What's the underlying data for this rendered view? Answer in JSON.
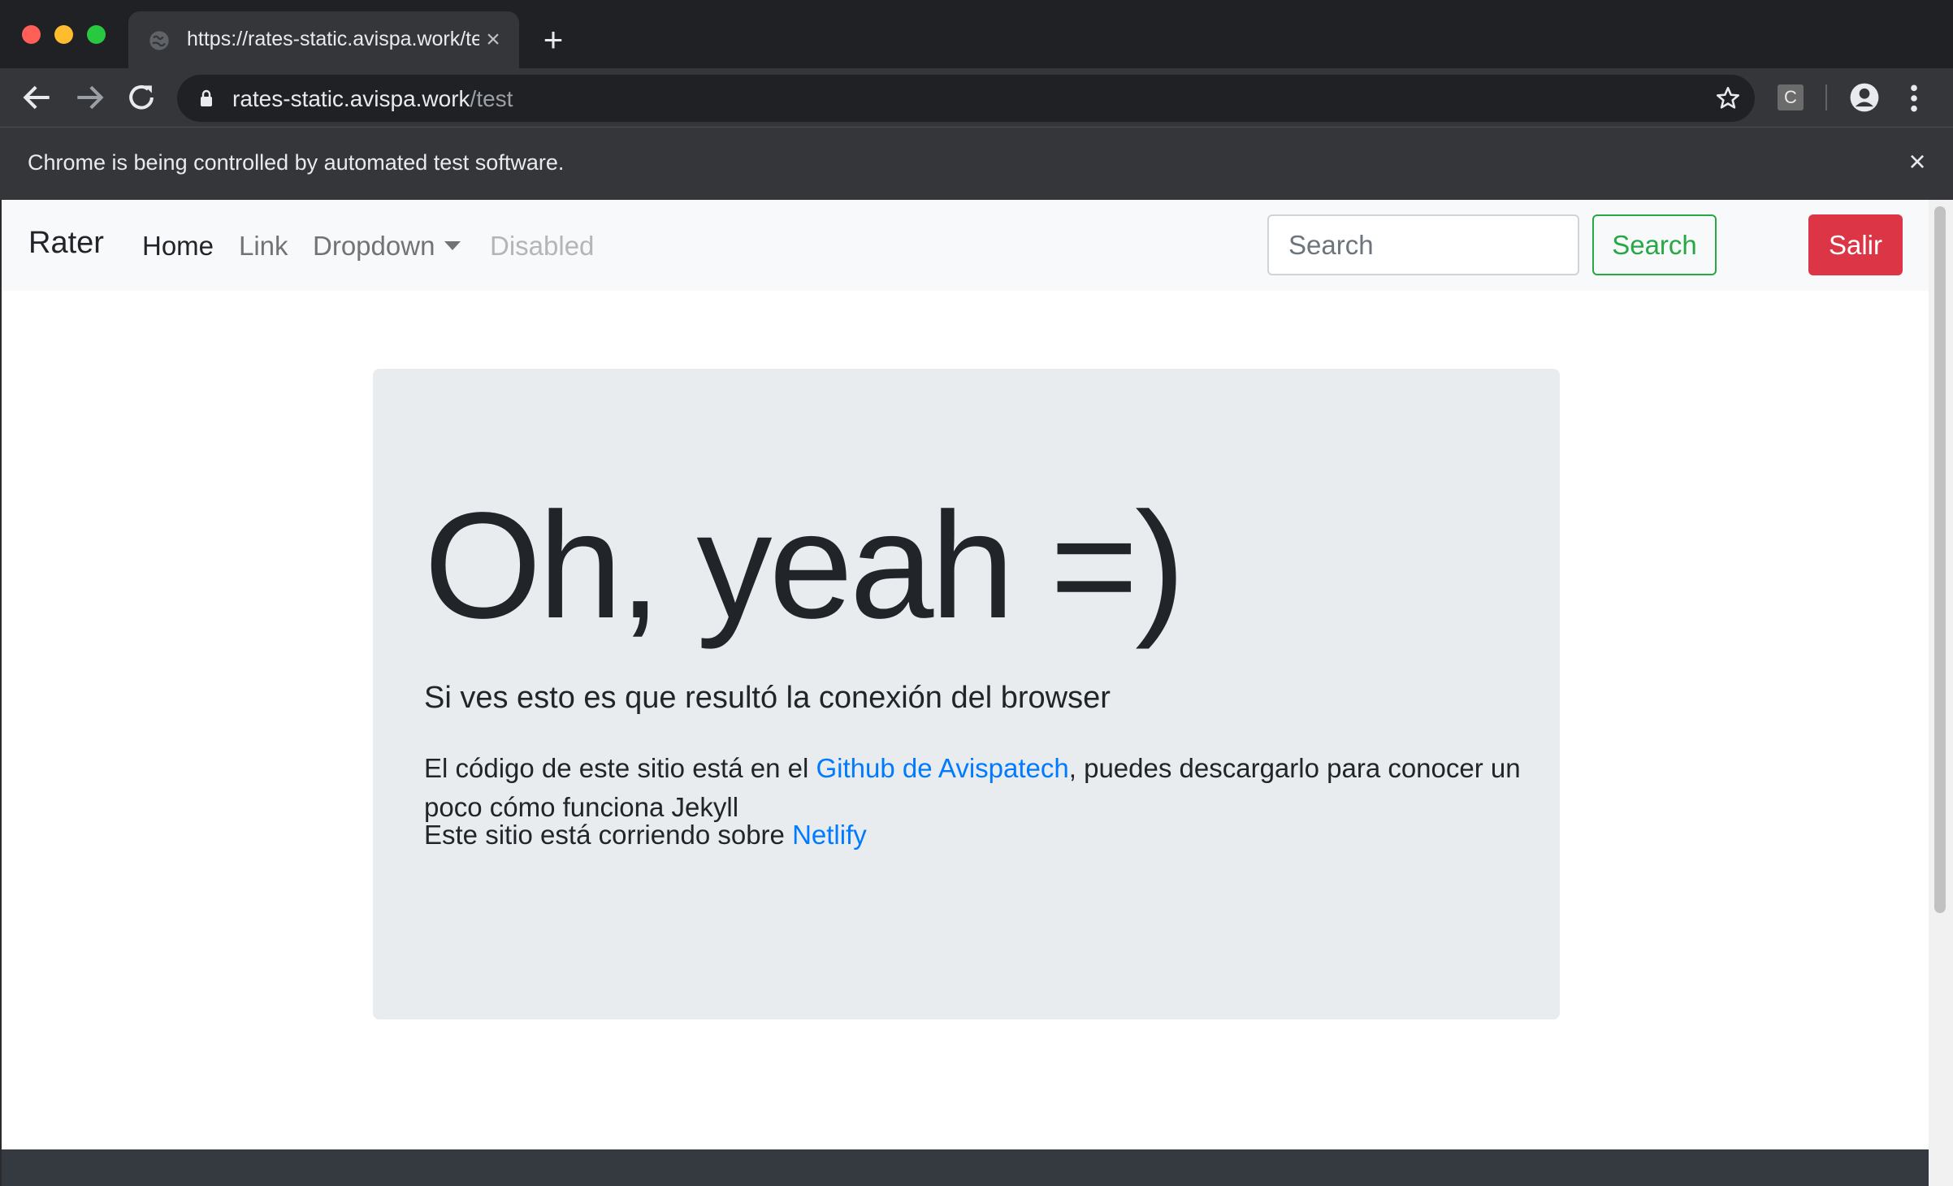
{
  "browser": {
    "tab_title": "https://rates-static.avispa.work/test",
    "url_host": "rates-static.avispa.work",
    "url_path": "/test",
    "extension_label": "C",
    "infobar_text": "Chrome is being controlled by automated test software."
  },
  "navbar": {
    "brand": "Rater",
    "links": [
      {
        "label": "Home"
      },
      {
        "label": "Link"
      },
      {
        "label": "Dropdown"
      },
      {
        "label": "Disabled"
      }
    ],
    "search_placeholder": "Search",
    "search_button": "Search",
    "logout_button": "Salir"
  },
  "jumbotron": {
    "heading": "Oh, yeah =)",
    "lead": "Si ves esto es que resultó la conexión del browser",
    "para1_before": "El código de este sitio está en el ",
    "para1_link": "Github de Avispatech",
    "para1_after": ", puedes descargarlo para conocer un poco cómo funciona Jekyll",
    "para2_before": "Este sitio está corriendo sobre ",
    "para2_link": "Netlify"
  },
  "colors": {
    "primary_link": "#007bff",
    "success": "#28a745",
    "danger": "#dc3545",
    "jumbotron_bg": "#e9ecef"
  }
}
